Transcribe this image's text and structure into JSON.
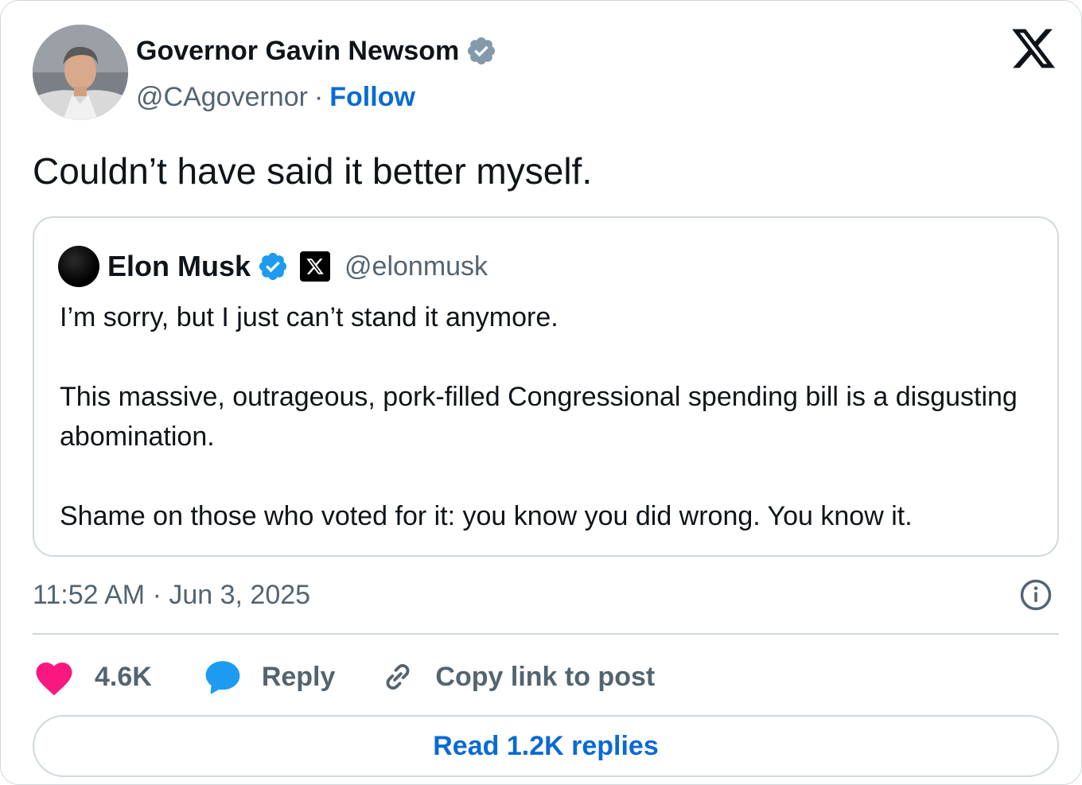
{
  "author": {
    "name": "Governor Gavin Newsom",
    "handle": "@CAgovernor",
    "separator": "·",
    "follow_label": "Follow"
  },
  "post": {
    "text": "Couldn’t have said it better myself."
  },
  "quoted": {
    "name": "Elon Musk",
    "handle": "@elonmusk",
    "paragraphs": [
      "I’m sorry, but I just can’t stand it anymore.",
      "This massive, outrageous, pork-filled Congressional spending bill is a disgusting abomination.",
      "Shame on those who voted for it: you know you did wrong. You know it."
    ]
  },
  "meta": {
    "timestamp": "11:52 AM · Jun 3, 2025"
  },
  "actions": {
    "like_count": "4.6K",
    "reply_label": "Reply",
    "copy_link_label": "Copy link to post"
  },
  "footer": {
    "read_replies_label": "Read 1.2K replies"
  },
  "colors": {
    "link_blue": "#0a6ad4",
    "verified_blue": "#1d9bf0",
    "verified_gray": "#829aab",
    "like_pink": "#f91880",
    "muted": "#536471",
    "border": "#cfd9de"
  },
  "icons": {
    "verified": "verified-badge-icon",
    "x_logo": "x-logo-icon",
    "info": "info-icon",
    "like": "heart-icon",
    "reply": "speech-bubble-icon",
    "copy_link": "link-icon"
  }
}
